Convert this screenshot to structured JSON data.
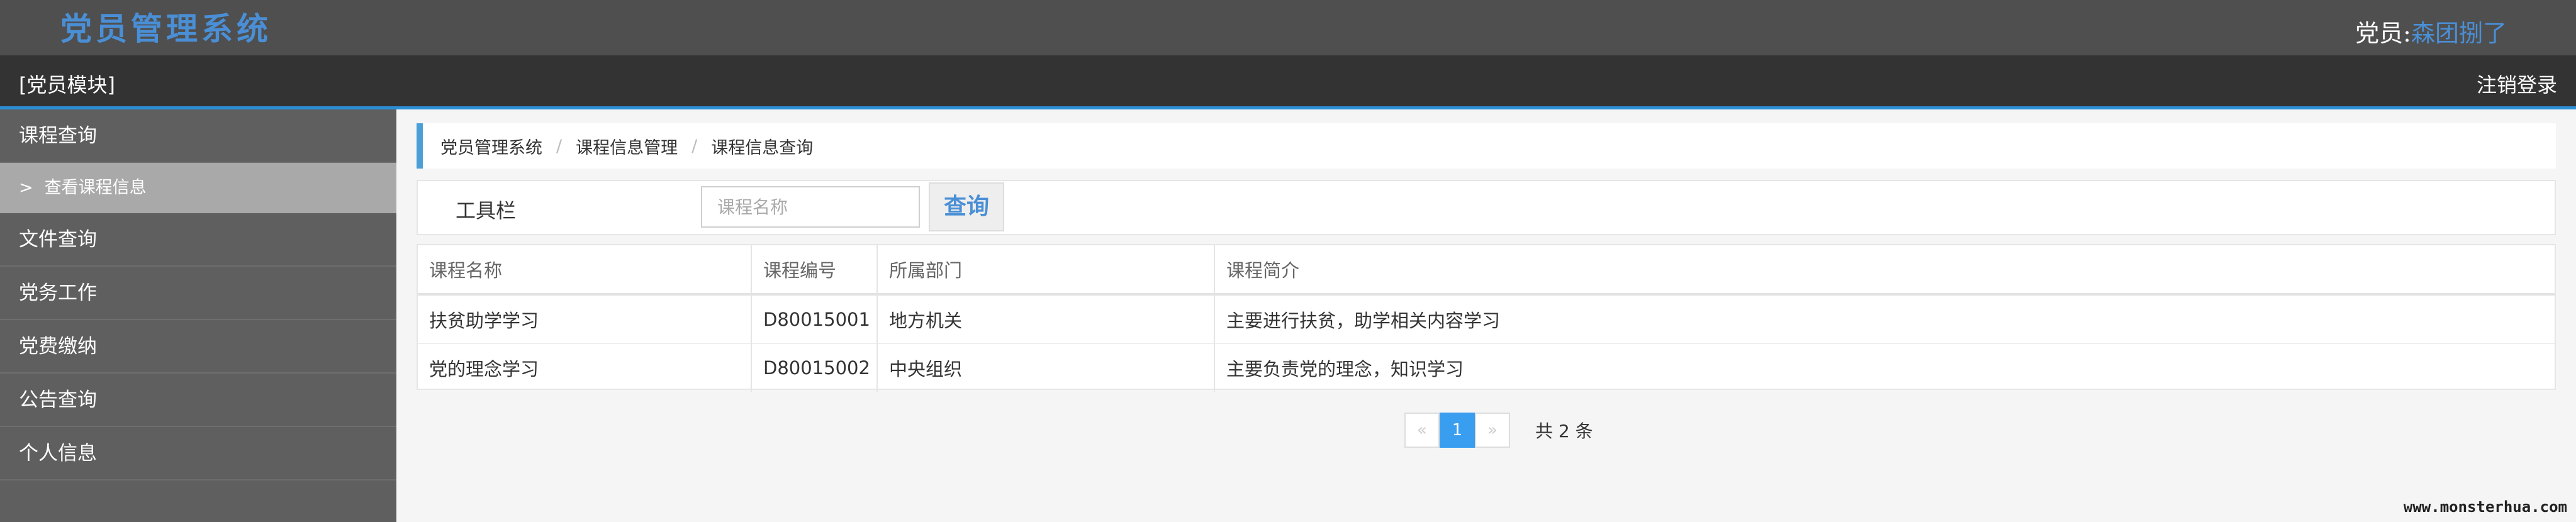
{
  "header": {
    "title": "党员管理系统",
    "user_label": "党员:",
    "user_name": "森团捌了"
  },
  "modulebar": {
    "module_label": "[党员模块]",
    "logout_label": "注销登录"
  },
  "sidebar": {
    "items": [
      {
        "label": "课程查询"
      },
      {
        "label": "查看课程信息",
        "chevron": ">"
      },
      {
        "label": "文件查询"
      },
      {
        "label": "党务工作"
      },
      {
        "label": "党费缴纳"
      },
      {
        "label": "公告查询"
      },
      {
        "label": "个人信息"
      }
    ]
  },
  "breadcrumb": [
    "党员管理系统",
    "课程信息管理",
    "课程信息查询"
  ],
  "breadcrumb_sep": "/",
  "toolbar": {
    "label": "工具栏",
    "input_placeholder": "课程名称",
    "input_value": "",
    "query_label": "查询"
  },
  "table": {
    "headers": [
      "课程名称",
      "课程编号",
      "所属部门",
      "课程简介"
    ],
    "rows": [
      [
        "扶贫助学学习",
        "D80015001",
        "地方机关",
        "主要进行扶贫，助学相关内容学习"
      ],
      [
        "党的理念学习",
        "D80015002",
        "中央组织",
        "主要负责党的理念，知识学习"
      ]
    ]
  },
  "pagination": {
    "prev": "«",
    "current": "1",
    "next": "»",
    "total": "共 2 条"
  },
  "watermark": "www.monsterhua.com",
  "colors": {
    "accent": "#4a8fd6",
    "active_page": "#3a9ef0",
    "header_bg": "#4f4f4f",
    "sidebar_bg": "#5f5f5f"
  }
}
